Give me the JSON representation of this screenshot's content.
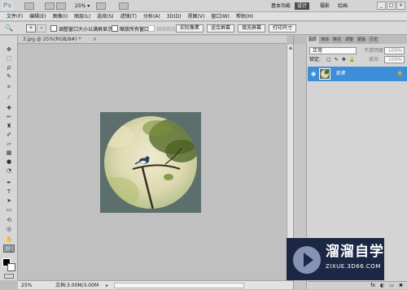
{
  "app": {
    "logo": "Ps",
    "zoom": "25%",
    "zoom_icon": "caret-down-icon"
  },
  "workspaces": [
    "基本功能",
    "设计",
    "摄影",
    "绘画"
  ],
  "active_workspace": "设计",
  "window_controls": [
    "_",
    "□",
    "×"
  ],
  "menu": [
    "文件(F)",
    "编辑(E)",
    "图像(I)",
    "图层(L)",
    "选择(S)",
    "滤镜(T)",
    "分析(A)",
    "3D(D)",
    "视图(V)",
    "窗口(W)",
    "帮助(H)"
  ],
  "options": {
    "resize_windows": "调整窗口大小以满屏显示",
    "zoom_all": "缩放所有窗口",
    "scrubby_zoom": "细微缩放",
    "actual_pixels": "实际像素",
    "fit_screen": "适合屏幕",
    "fill_screen": "填充屏幕",
    "print_size": "打印尺寸"
  },
  "tools": [
    "move-icon",
    "marquee-icon",
    "lasso-icon",
    "quick-select-icon",
    "crop-icon",
    "eyedropper-icon",
    "healing-icon",
    "brush-icon",
    "stamp-icon",
    "history-brush-icon",
    "eraser-icon",
    "gradient-icon",
    "blur-icon",
    "dodge-icon",
    "pen-icon",
    "type-icon",
    "path-select-icon",
    "shape-icon",
    "3d-rotate-icon",
    "3d-orbit-icon",
    "hand-icon",
    "zoom-icon"
  ],
  "document": {
    "tab": "3.jpg @ 25%(RGB/8#) *",
    "close": "×",
    "zoom": "25%",
    "doc_size": "文档:3.00M/3.00M",
    "canvas_bg": "#5c6f6c"
  },
  "panel": {
    "tabs": [
      "图层",
      "通道",
      "路径",
      "调整",
      "蒙版",
      "历史"
    ],
    "blend_mode": "正常",
    "opacity_label": "不透明度:",
    "opacity_value": "100%",
    "lock_label": "锁定:",
    "fill_label": "填充:",
    "fill_value": "100%",
    "layer_name": "背景",
    "bottom_icons": [
      "fx",
      "◐",
      "▭",
      "✖"
    ]
  },
  "watermark": {
    "title": "溜溜自学",
    "url": "ZIXUE.3D66.COM"
  },
  "colors": {
    "accent_blue": "#3d8ed8",
    "watermark_bg": "#1c2744"
  }
}
